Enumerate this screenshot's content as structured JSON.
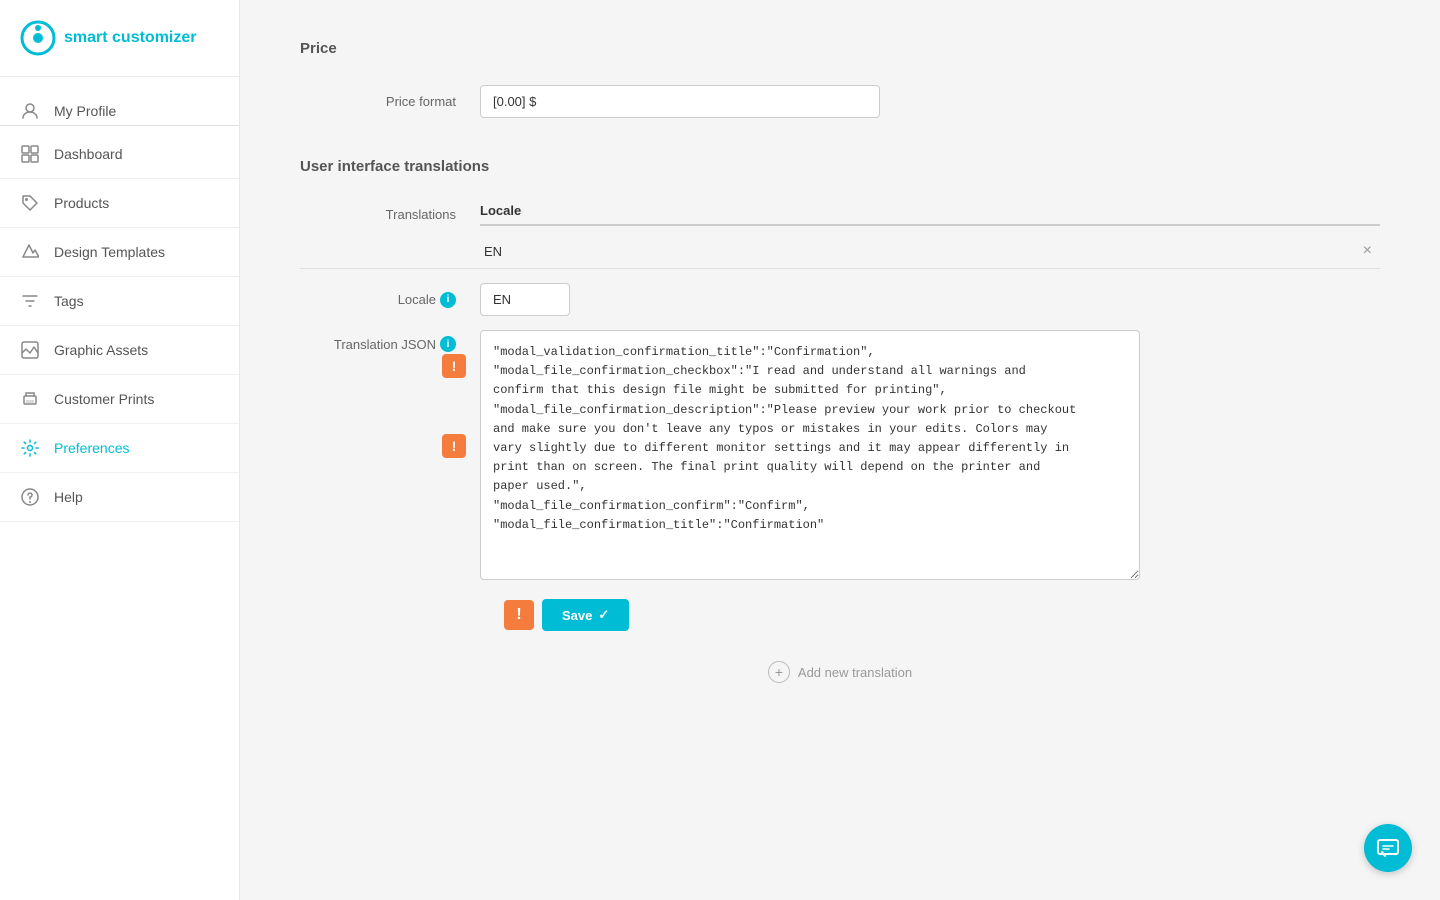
{
  "app": {
    "logo_text": "smart customizer"
  },
  "sidebar": {
    "items": [
      {
        "id": "my-profile",
        "label": "My Profile",
        "icon": "user-icon",
        "active": false,
        "divider": true
      },
      {
        "id": "dashboard",
        "label": "Dashboard",
        "icon": "dashboard-icon",
        "active": false
      },
      {
        "id": "products",
        "label": "Products",
        "icon": "tag-icon",
        "active": false
      },
      {
        "id": "design-templates",
        "label": "Design Templates",
        "icon": "design-icon",
        "active": false
      },
      {
        "id": "tags",
        "label": "Tags",
        "icon": "filter-icon",
        "active": false
      },
      {
        "id": "graphic-assets",
        "label": "Graphic Assets",
        "icon": "graphic-icon",
        "active": false
      },
      {
        "id": "customer-prints",
        "label": "Customer Prints",
        "icon": "prints-icon",
        "active": false
      },
      {
        "id": "preferences",
        "label": "Preferences",
        "icon": "gear-icon",
        "active": true
      },
      {
        "id": "help",
        "label": "Help",
        "icon": "help-icon",
        "active": false
      }
    ]
  },
  "main": {
    "price_section_title": "Price",
    "price_format_label": "Price format",
    "price_format_value": "[0.00] $",
    "ui_translations_title": "User interface translations",
    "translations_label": "Translations",
    "translations_col_header": "Locale",
    "locale_value": "EN",
    "locale_label": "Locale",
    "locale_info": "i",
    "locale_field_value": "EN",
    "translation_json_label": "Translation JSON",
    "translation_json_info": "i",
    "json_content": "\"modal_validation_confirmation_title\":\"Confirmation\",\n\"modal_file_confirmation_checkbox\":\"I read and understand all warnings and\nconfirm that this design file might be submitted for printing\",\n\"modal_file_confirmation_description\":\"Please preview your work prior to checkout\nand make sure you don't leave any typos or mistakes in your edits. Colors may\nvary slightly due to different monitor settings and it may appear differently in\nprint than on screen. The final print quality will depend on the printer and\npaper used.\",\n\"modal_file_confirmation_confirm\":\"Confirm\",\n\"modal_file_confirmation_title\":\"Confirmation\"",
    "error_marker_label": "!",
    "save_label": "Save",
    "save_check": "✓",
    "add_translation_label": "Add new translation"
  }
}
